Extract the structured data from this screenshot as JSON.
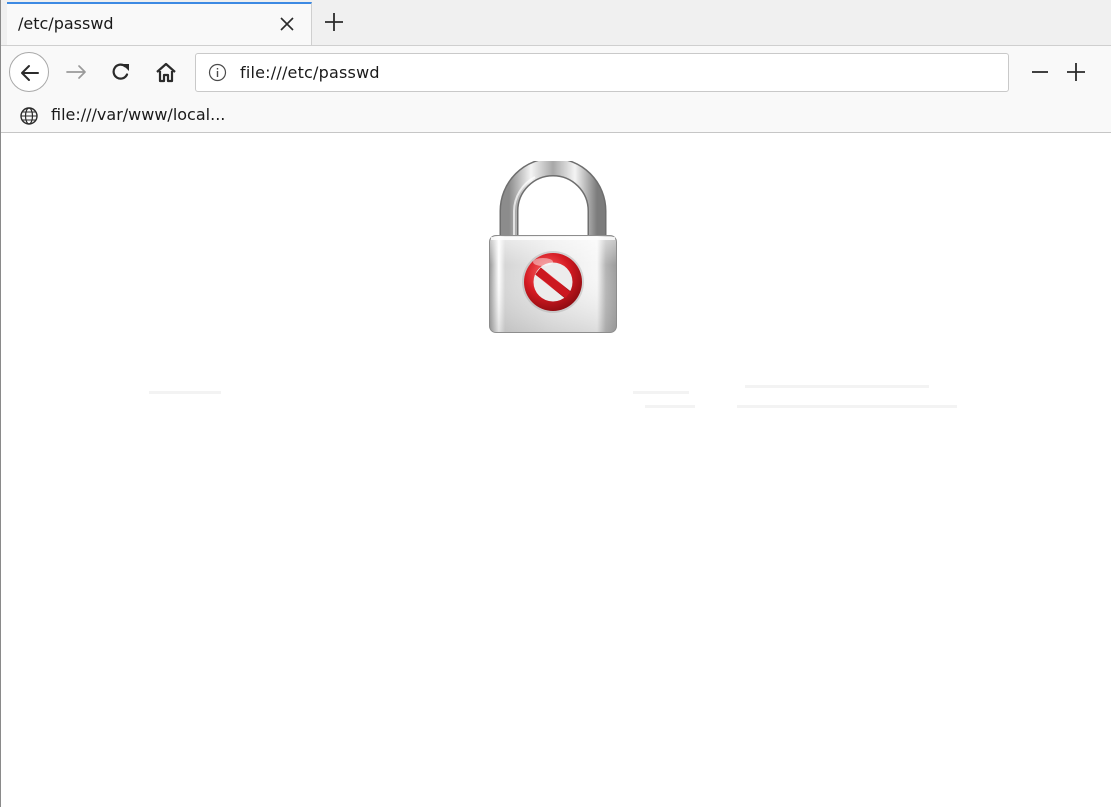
{
  "tab": {
    "title": "/etc/passwd"
  },
  "toolbar": {
    "url": "file:///etc/passwd"
  },
  "bookmarks": {
    "items": [
      {
        "label": "file:///var/www/local...",
        "icon": "globe-icon"
      }
    ]
  },
  "content": {
    "image": "lock-blocked-icon"
  },
  "colors": {
    "tab_accent": "#3d8ae3",
    "blocked_red": "#c8161e"
  }
}
